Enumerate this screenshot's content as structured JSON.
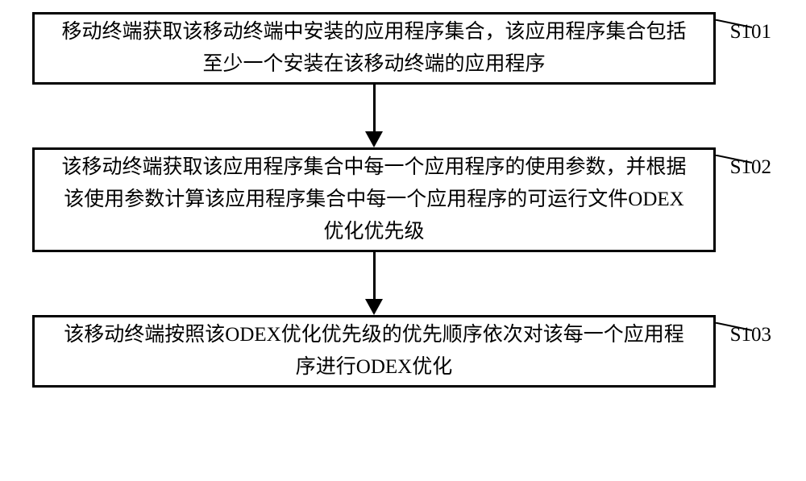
{
  "flowchart": {
    "steps": [
      {
        "text": "移动终端获取该移动终端中安装的应用程序集合，该应用程序集合包括至少一个安装在该移动终端的应用程序",
        "label": "S101"
      },
      {
        "text": "该移动终端获取该应用程序集合中每一个应用程序的使用参数，并根据该使用参数计算该应用程序集合中每一个应用程序的可运行文件ODEX优化优先级",
        "label": "S102"
      },
      {
        "text": "该移动终端按照该ODEX优化优先级的优先顺序依次对该每一个应用程序进行ODEX优化",
        "label": "S103"
      }
    ]
  }
}
